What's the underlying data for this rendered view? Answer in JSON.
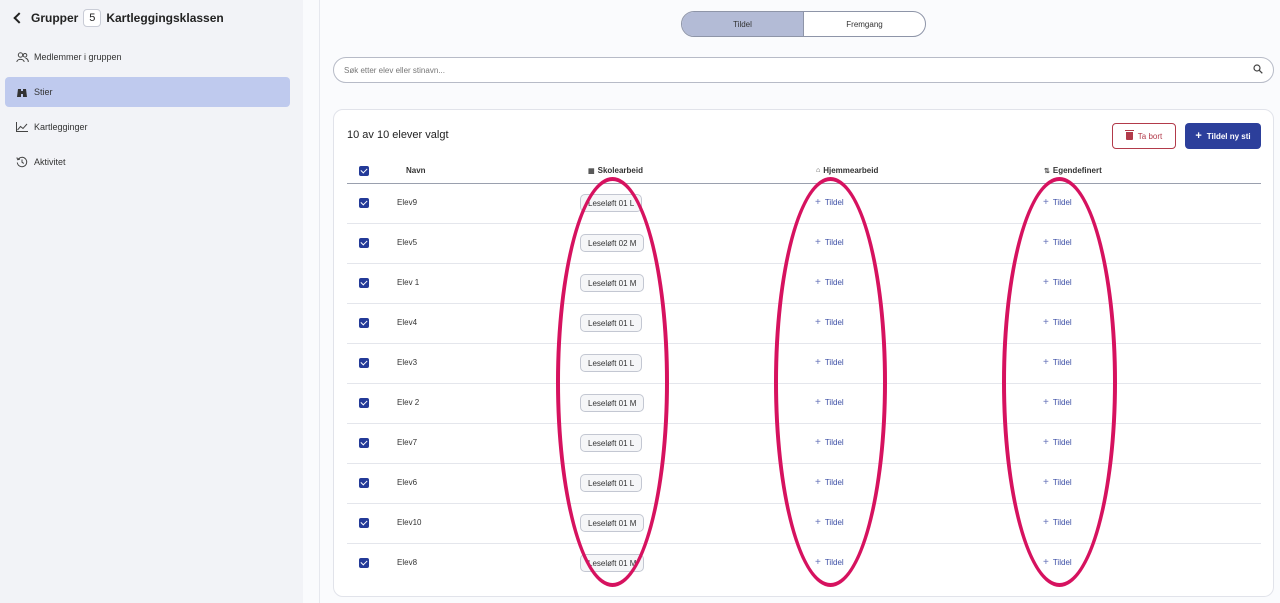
{
  "sidebar": {
    "back_label": "Grupper",
    "group_count": "5",
    "group_name": "Kartleggingsklassen",
    "items": [
      {
        "label": "Medlemmer i gruppen",
        "icon": "users-icon",
        "active": false
      },
      {
        "label": "Stier",
        "icon": "binoculars-icon",
        "active": true
      },
      {
        "label": "Kartlegginger",
        "icon": "chart-line-icon",
        "active": false
      },
      {
        "label": "Aktivitet",
        "icon": "history-icon",
        "active": false
      }
    ]
  },
  "tabs": {
    "assign": "Tildel",
    "progress": "Fremgang",
    "active": "Tildel"
  },
  "search": {
    "placeholder": "Søk etter elev eller stinavn..."
  },
  "card": {
    "title": "10 av 10 elever valgt",
    "delete_label": "Ta bort",
    "assign_new_label": "Tildel ny sti"
  },
  "table": {
    "columns": {
      "name": "Navn",
      "school": "Skolearbeid",
      "home": "Hjemmearbeid",
      "custom": "Egendefinert"
    },
    "assign_label": "Tildel",
    "rows": [
      {
        "name": "Elev9",
        "school": "Leseløft 01 L"
      },
      {
        "name": "Elev5",
        "school": "Leseløft 02 M"
      },
      {
        "name": "Elev 1",
        "school": "Leseløft 01 M"
      },
      {
        "name": "Elev4",
        "school": "Leseløft 01 L"
      },
      {
        "name": "Elev3",
        "school": "Leseløft 01 L"
      },
      {
        "name": "Elev 2",
        "school": "Leseløft 01 M"
      },
      {
        "name": "Elev7",
        "school": "Leseløft 01 L"
      },
      {
        "name": "Elev6",
        "school": "Leseløft 01 L"
      },
      {
        "name": "Elev10",
        "school": "Leseløft 01 M"
      },
      {
        "name": "Elev8",
        "school": "Leseløft 01 M"
      }
    ]
  },
  "colors": {
    "primary": "#2c3f9b",
    "active_nav": "#bfcaee",
    "delete": "#b23a4a",
    "annotation": "#d6125f"
  }
}
